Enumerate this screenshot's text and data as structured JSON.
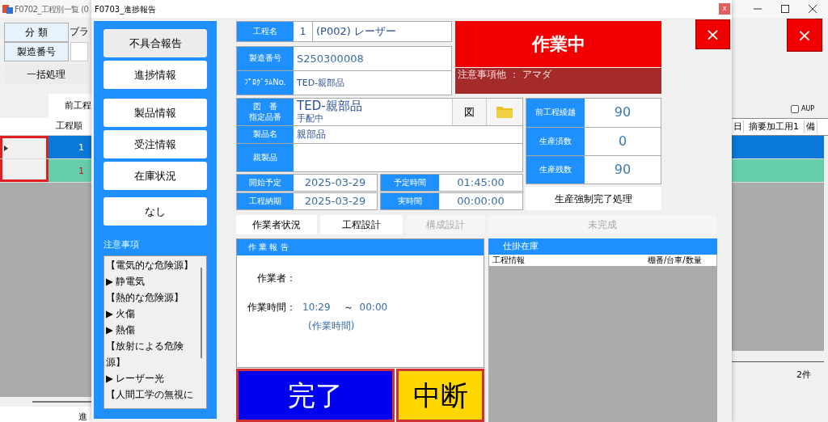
{
  "main_window": {
    "title": "F0702_工程別一覧 (0",
    "filters": [
      {
        "label": "分 類",
        "value": "ブラ"
      },
      {
        "label": "製造番号"
      }
    ],
    "batch_button": "一括処理",
    "tab": "前工程",
    "aup": {
      "label": "AUP",
      "checked": false
    },
    "columns_left": [
      "工程順"
    ],
    "columns_right": [
      "日",
      "摘要加工用1",
      "備"
    ],
    "rows": [
      {
        "order": "1",
        "selected": true,
        "kind": "current"
      },
      {
        "order": "1",
        "selected": false,
        "kind": "next"
      }
    ],
    "status_left": "進",
    "status_right": "2件",
    "close": "×"
  },
  "dialog": {
    "title": "F0703_進捗報告",
    "close": "x",
    "side_buttons": [
      {
        "label": "不具合報告",
        "highlighted": true
      },
      {
        "label": "進捗情報",
        "highlighted": false
      },
      {
        "label": "製品情報",
        "highlighted": false
      },
      {
        "label": "受注情報",
        "highlighted": false
      },
      {
        "label": "在庫状況",
        "highlighted": false
      },
      {
        "label": "なし",
        "highlighted": false
      }
    ],
    "notes": {
      "label": "注意事項",
      "lines": [
        "【電気的な危険源】",
        "▶ 静電気",
        "【熱的な危険源】",
        "▶ 火傷",
        "▶ 熱傷",
        "【放射による危険源】",
        "▶ レーザー光",
        "【人間工学の無視に"
      ]
    },
    "process": {
      "label": "工程名",
      "number": "1",
      "name": "(P002) レーザー"
    },
    "status": {
      "label": "作業中",
      "note": "注意事項他 ： アマダ"
    },
    "close_button": "×",
    "serial": {
      "label": "製造番号",
      "value": "S250300008"
    },
    "program": {
      "label": "ﾌﾟﾛｸﾞﾗﾑNo.",
      "value": "TED-親部品"
    },
    "drawing": {
      "label_1": "図　番",
      "label_2": "指定品番",
      "value": "TED-親部品",
      "sub": "手配中",
      "button": "図"
    },
    "product": {
      "label": "製品名",
      "value": "親部品"
    },
    "parent": {
      "label": "親製品"
    },
    "dates": [
      {
        "label": "開始予定",
        "value": "2025-03-29",
        "label_2": "予定時間",
        "value_2": "01:45:00"
      },
      {
        "label": "工程納期",
        "value": "2025-03-29",
        "label_2": "実時間",
        "value_2": "00:00:00"
      }
    ],
    "counts": [
      {
        "label": "前工程繰越",
        "value": "90"
      },
      {
        "label": "生産済数",
        "value": "0"
      },
      {
        "label": "生産残数",
        "value": "90"
      }
    ],
    "force_button": "生産強制完了処理",
    "tabs": [
      {
        "label": "作業者状況",
        "disabled": false
      },
      {
        "label": "工程設計",
        "disabled": false
      },
      {
        "label": "構成設計",
        "disabled": true
      },
      {
        "label": "未完成",
        "disabled": true
      }
    ],
    "report": {
      "title": "作 業 報 告",
      "worker_label": "作業者：",
      "time_label": "作業時間：",
      "start": "10:29",
      "sep": "～",
      "end": "00:00",
      "note": "(作業時間)"
    },
    "complete_button": "完了",
    "pause_button": "中断",
    "wip": {
      "title": "仕掛在庫",
      "columns": [
        "工程情報",
        "棚番/台車/数量"
      ]
    }
  }
}
